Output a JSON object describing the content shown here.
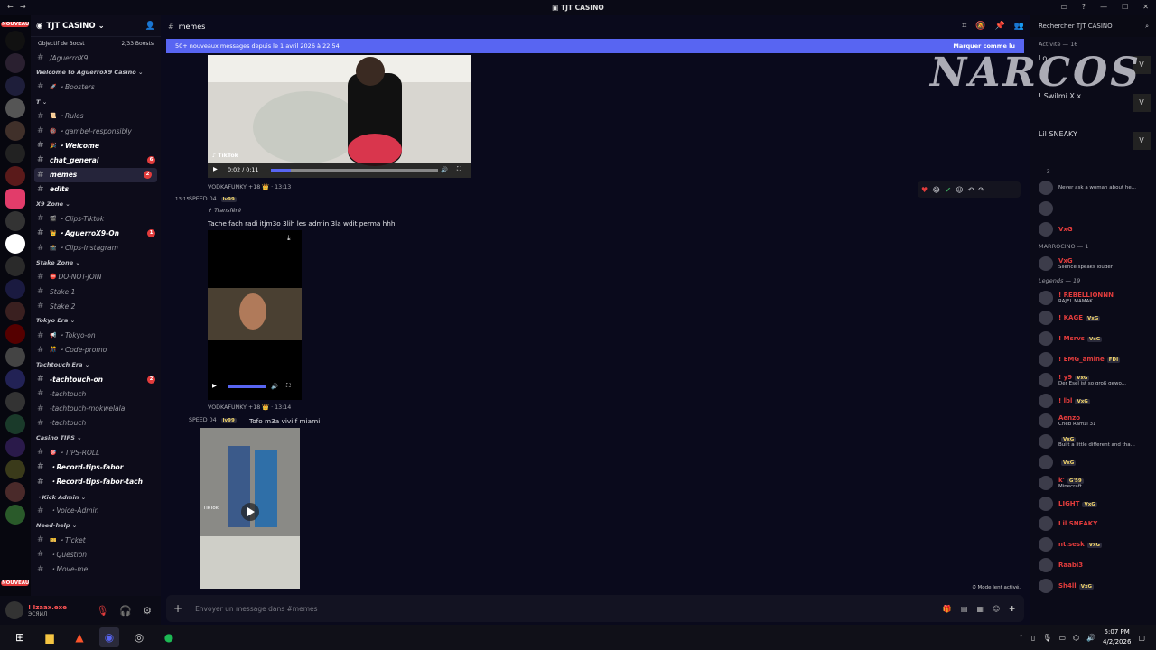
{
  "window": {
    "title": "TJT CASINO"
  },
  "server_rail": {
    "top_tag": "NOUVEAU",
    "bottom_tag": "NOUVEAU"
  },
  "guild": {
    "name": "TJT CASINO",
    "boost_goal": "Objectif de Boost",
    "boost_count": "2/33 Boosts"
  },
  "channels": [
    {
      "type": "ch",
      "label": "/AguerroX9",
      "bold": false
    },
    {
      "type": "cat",
      "label": "Welcome to AguerroX9 Casino"
    },
    {
      "type": "ch",
      "label": "・Boosters",
      "icon": "🚀",
      "bold": false
    },
    {
      "type": "cat",
      "label": "T"
    },
    {
      "type": "ch",
      "label": "・Rules",
      "icon": "📜",
      "bold": false
    },
    {
      "type": "ch",
      "label": "・gambel-responsibly",
      "icon": "🔞",
      "bold": false
    },
    {
      "type": "ch",
      "label": "・Welcome",
      "icon": "🎉",
      "bold": true
    },
    {
      "type": "ch",
      "label": "chat_general",
      "bold": true,
      "badge": "6"
    },
    {
      "type": "ch",
      "label": "memes",
      "bold": true,
      "active": true,
      "badge": "2"
    },
    {
      "type": "ch",
      "label": "edits",
      "bold": true
    },
    {
      "type": "cat",
      "label": "X9 Zone"
    },
    {
      "type": "ch",
      "label": "・Clips-Tiktok",
      "icon": "🎬",
      "bold": false
    },
    {
      "type": "ch",
      "label": "・AguerroX9-On",
      "icon": "👑",
      "bold": true,
      "badge": "1"
    },
    {
      "type": "ch",
      "label": "・Clips-Instagram",
      "icon": "📸",
      "bold": false
    },
    {
      "type": "cat",
      "label": "Stake Zone"
    },
    {
      "type": "ch",
      "label": "DO-NOT-JOIN",
      "icon": "⛔",
      "bold": false
    },
    {
      "type": "ch",
      "label": "Stake 1",
      "bold": false
    },
    {
      "type": "ch",
      "label": "Stake 2",
      "bold": false
    },
    {
      "type": "cat",
      "label": "Tokyo Era"
    },
    {
      "type": "ch",
      "label": "・Tokyo-on",
      "icon": "📢",
      "bold": false
    },
    {
      "type": "ch",
      "label": "・Code-promo",
      "icon": "🎊",
      "bold": false
    },
    {
      "type": "cat",
      "label": "Tachtouch Era"
    },
    {
      "type": "ch",
      "label": "-tachtouch-on",
      "bold": true,
      "badge": "2"
    },
    {
      "type": "ch",
      "label": "-tachtouch",
      "bold": false
    },
    {
      "type": "ch",
      "label": "-tachtouch-mokwelala",
      "bold": false
    },
    {
      "type": "ch",
      "label": "-tachtouch",
      "bold": false
    },
    {
      "type": "cat",
      "label": "Casino TIPS"
    },
    {
      "type": "ch",
      "label": "・TIPS-ROLL",
      "icon": "🎯",
      "bold": false
    },
    {
      "type": "ch",
      "label": "・Record-tips-fabor",
      "bold": true
    },
    {
      "type": "ch",
      "label": "・Record-tips-fabor-tach",
      "bold": true
    },
    {
      "type": "cat",
      "label": "・Kick Admin"
    },
    {
      "type": "ch",
      "label": "・Voice-Admin",
      "bold": false
    },
    {
      "type": "cat",
      "label": "Need-help"
    },
    {
      "type": "ch",
      "label": "・Ticket",
      "icon": "🎫",
      "bold": false
    },
    {
      "type": "ch",
      "label": "・Question",
      "bold": false
    },
    {
      "type": "ch",
      "label": "・Move-me",
      "bold": false
    }
  ],
  "user": {
    "name": "! Izaax.exe",
    "status": "ЭСЯИЛ"
  },
  "header": {
    "channel": "memes"
  },
  "new_messages": {
    "text": "50+ nouveaux messages depuis le 1 avril 2026 à 22:54",
    "mark": "Marquer comme lu"
  },
  "video1": {
    "time": "0:02 / 0:11",
    "brand": "TikTok"
  },
  "msg1": {
    "author": "VODKAFUNKY +18 👑 · 13:13",
    "time_left": "13:15",
    "speaker": "SPEED 04",
    "tag": "lv99",
    "forward": "Transféré",
    "text": "Tache fach radi itjm3o 3lih les admin 3la wdit perma hhh"
  },
  "msg2": {
    "author": "VODKAFUNKY +18 👑 · 13:14",
    "speaker": "SPEED 04",
    "tag": "lv99",
    "text": "Tofo m3a vivi f miami"
  },
  "video2": {
    "brand": "TikTok"
  },
  "composer": {
    "placeholder": "Envoyer un message dans #memes",
    "slowmode": "Mode lent activé."
  },
  "overlay": {
    "brand": "NARCOS"
  },
  "members": {
    "search": "Rechercher TJT CASINO",
    "activity_header": "Activité — 16",
    "activity": [
      {
        "name": "Lo. ....",
        "game": "Grand Theft Auto V Legacy",
        "sub": ""
      },
      {
        "name": "! Swilmi X x",
        "game": "Grand Theft Auto V Legacy",
        "sub": "Il y a 1j"
      },
      {
        "name": "Lil SNEAKY",
        "game": "Grand Theft Auto V Legacy",
        "sub": "Il y a 4j · Série de 3 j cons..."
      }
    ],
    "section2": "— 3",
    "group1": [
      {
        "name": "",
        "sub": "Never ask a woman about he..."
      },
      {
        "name": "",
        "sub": ""
      },
      {
        "name": "VxG",
        "sub": ""
      }
    ],
    "section3": "MARROCINO — 1",
    "group2": [
      {
        "name": "VxG",
        "sub": "Silence speaks louder"
      }
    ],
    "section4": "Legends — 19",
    "group3": [
      {
        "name": "! REBELLIONNN",
        "sub": "RAJEL MAMAK"
      },
      {
        "name": "! KAGE",
        "tag": "VxG",
        "sub": ""
      },
      {
        "name": "! Msrvs",
        "tag": "VxG",
        "sub": ""
      },
      {
        "name": "! EMG_amine",
        "tag": "FDI",
        "sub": ""
      },
      {
        "name": "! y9",
        "tag": "VxG",
        "sub": "Der Esel ist so groß gewo..."
      },
      {
        "name": "! lbl",
        "tag": "VxG",
        "sub": ""
      },
      {
        "name": "Aenzo",
        "sub": "Cheb Ramzi 31"
      },
      {
        "name": "",
        "tag": "VxG",
        "sub": "Built a little different and tha..."
      },
      {
        "name": "",
        "tag": "VxG",
        "sub": ""
      },
      {
        "name": "k'",
        "tag": "G'59",
        "sub": "Minecraft"
      },
      {
        "name": "LIGHT",
        "tag": "VxG",
        "sub": ""
      },
      {
        "name": "Lil SNEAKY",
        "sub": ""
      },
      {
        "name": "nt.sesk",
        "tag": "VxG",
        "sub": ""
      },
      {
        "name": "Raabi3",
        "sub": ""
      },
      {
        "name": "Sh4ll",
        "tag": "VxG",
        "sub": ""
      }
    ]
  },
  "taskbar": {
    "time": "5:07 PM",
    "date": "4/2/2026"
  }
}
